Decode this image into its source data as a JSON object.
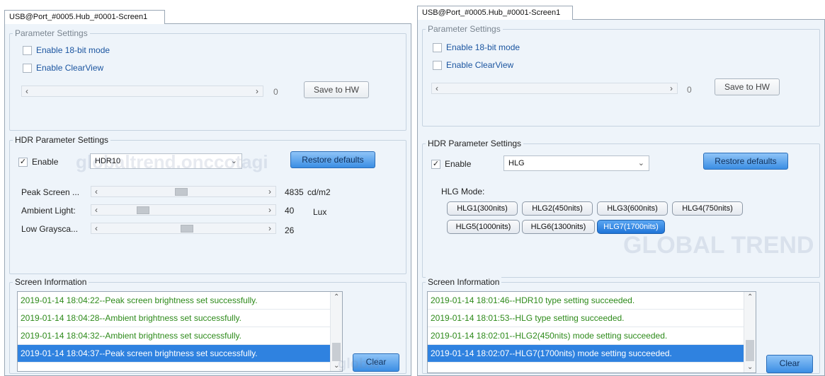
{
  "left": {
    "tab_title": "USB@Port_#0005.Hub_#0001-Screen1",
    "parameter_settings": {
      "legend": "Parameter Settings",
      "enable_18bit": "Enable 18-bit mode",
      "enable_clearview": "Enable ClearView",
      "slider_value": "0",
      "save_button": "Save to HW"
    },
    "hdr": {
      "legend": "HDR Parameter Settings",
      "enable_label": "Enable",
      "enable_checked": true,
      "mode_selected": "HDR10",
      "restore_button": "Restore defaults",
      "sliders": [
        {
          "label": "Peak Screen ...",
          "value": "4835",
          "unit": "cd/m2",
          "level": 0.5
        },
        {
          "label": "Ambient Light:",
          "value": "40",
          "unit": "Lux",
          "level": 0.2
        },
        {
          "label": "Low Graysca...",
          "value": "26",
          "unit": "",
          "level": 0.55
        }
      ]
    },
    "screen_info": {
      "legend": "Screen Information",
      "rows": [
        "2019-01-14 18:04:22--Peak screen brightness set successfully.",
        "2019-01-14 18:04:28--Ambient brightness set successfully.",
        "2019-01-14 18:04:32--Ambient brightness set successfully.",
        "2019-01-14 18:04:37--Peak screen brightness set successfully."
      ],
      "selected_index": 3,
      "clear_button": "Clear"
    }
  },
  "right": {
    "tab_title": "USB@Port_#0005.Hub_#0001-Screen1",
    "parameter_settings": {
      "legend": "Parameter Settings",
      "enable_18bit": "Enable 18-bit mode",
      "enable_clearview": "Enable ClearView",
      "slider_value": "0",
      "save_button": "Save to HW"
    },
    "hdr": {
      "legend": "HDR Parameter Settings",
      "enable_label": "Enable",
      "enable_checked": true,
      "mode_selected": "HLG",
      "restore_button": "Restore defaults",
      "hlg_mode_label": "HLG Mode:",
      "hlg_modes": [
        "HLG1(300nits)",
        "HLG2(450nits)",
        "HLG3(600nits)",
        "HLG4(750nits)",
        "HLG5(1000nits)",
        "HLG6(1300nits)",
        "HLG7(1700nits)"
      ],
      "hlg_active_index": 6
    },
    "screen_info": {
      "legend": "Screen Information",
      "rows": [
        "2019-01-14 18:01:46--HDR10 type setting succeeded.",
        "2019-01-14 18:01:53--HLG type setting succeeded.",
        "2019-01-14 18:02:01--HLG2(450nits) mode setting succeeded.",
        "2019-01-14 18:02:07--HLG7(1700nits) mode setting succeeded."
      ],
      "selected_index": 3,
      "clear_button": "Clear"
    }
  },
  "watermark": {
    "left_text": "globaltrend.onccotagi",
    "right_text": "GLOBAL TREND",
    "bottom_text": "global"
  },
  "colors": {
    "panel_bg": "#eef4fa",
    "log_text_green": "#2d8a1a",
    "selection_blue": "#2f82e0",
    "button_blue": "#3b8ee4"
  }
}
